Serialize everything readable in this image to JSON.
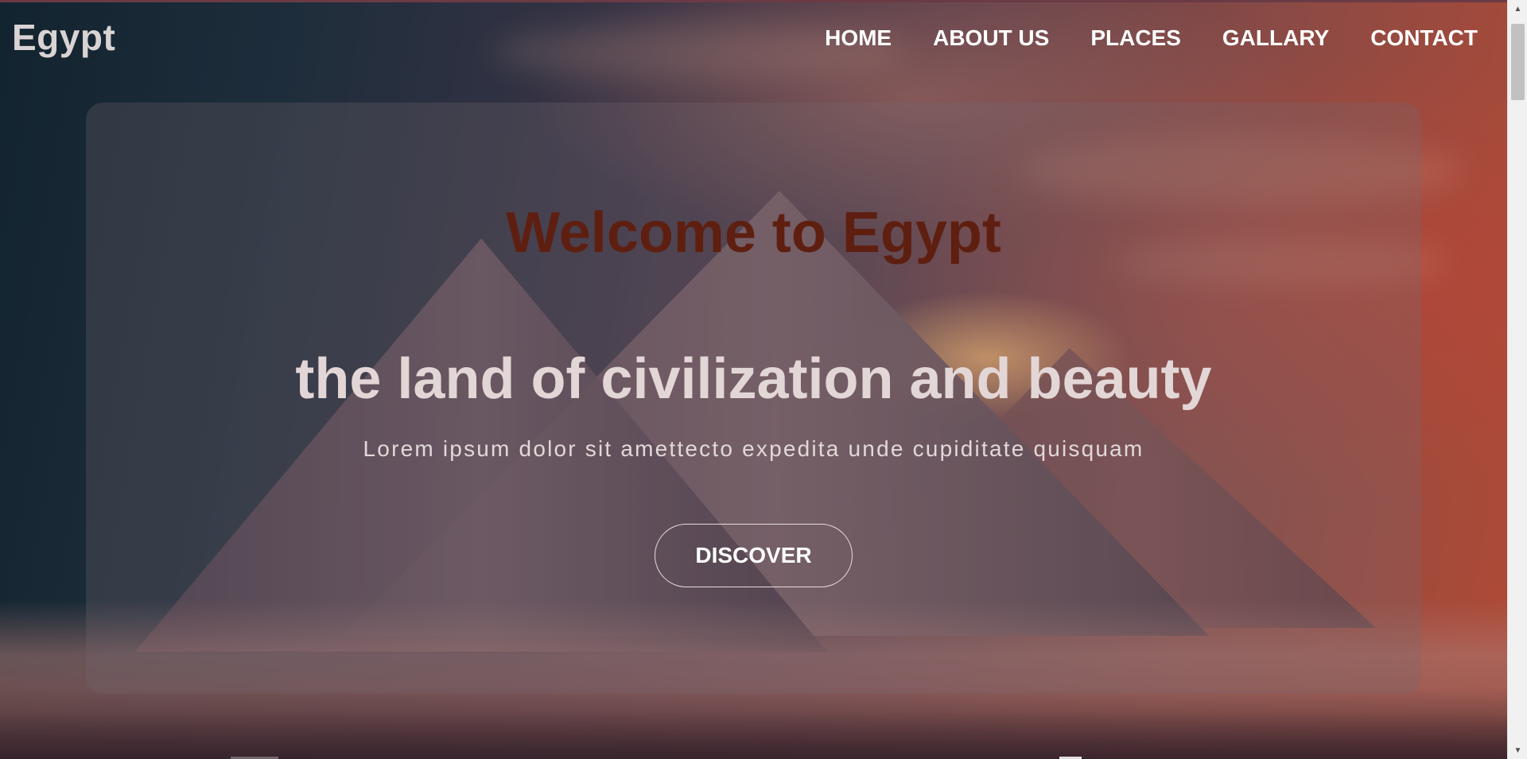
{
  "header": {
    "logo": "Egypt",
    "nav": [
      {
        "label": "HOME"
      },
      {
        "label": "ABOUT US"
      },
      {
        "label": "PLACES"
      },
      {
        "label": "GALLARY"
      },
      {
        "label": "CONTACT"
      }
    ]
  },
  "hero": {
    "welcome": "Welcome to Egypt",
    "tagline": "the land of civilization and beauty",
    "description": "Lorem ipsum dolor sit amettecto expedita unde cupiditate quisquam",
    "cta_label": "DISCOVER"
  },
  "colors": {
    "welcome_text": "#5e1f10",
    "tagline_text": "#e3d6d6",
    "nav_text": "#ffffff"
  },
  "icons": {
    "scroll_up": "triangle-up-icon",
    "scroll_down": "triangle-down-icon"
  }
}
